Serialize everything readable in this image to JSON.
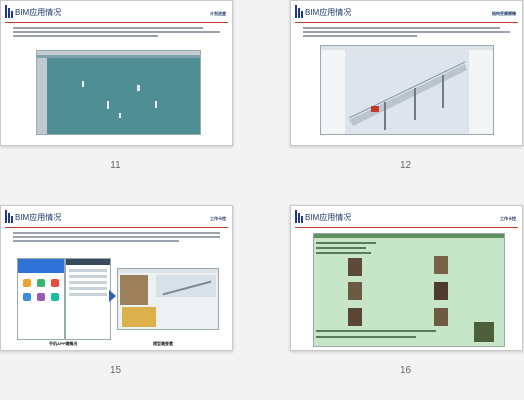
{
  "slides": [
    {
      "number": "11",
      "title": "BIM应用情况",
      "tag": "计划进度"
    },
    {
      "number": "12",
      "title": "BIM应用情况",
      "tag": "结构受摩擦情"
    },
    {
      "number": "15",
      "title": "BIM应用情况",
      "tag": "工作卡控",
      "captions": [
        "手机APP端情况",
        "模型端查看"
      ]
    },
    {
      "number": "16",
      "title": "BIM应用情况",
      "tag": "工作卡控"
    }
  ],
  "colors": {
    "brand": "#1f3a8a",
    "accent": "#c0392b",
    "model_bg": "#4f8e93",
    "table_bg": "#c7e6c7"
  }
}
